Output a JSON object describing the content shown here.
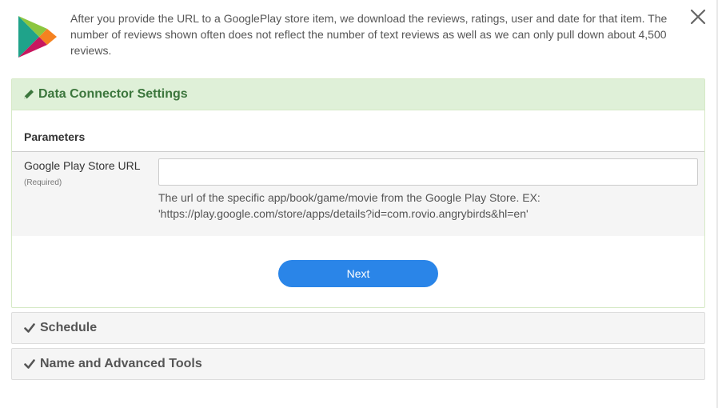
{
  "header": {
    "logo_icon": "google-play-logo-icon",
    "intro_text": "After you provide the URL to a GooglePlay store item, we download the reviews, ratings, user and date for that item. The number of reviews shown often does not reflect the number of text reviews as well as we can only pull down about 4,500 reviews.",
    "close_icon": "close-icon"
  },
  "settings_panel": {
    "title": "Data Connector Settings",
    "title_icon": "pencil-icon",
    "parameters_label": "Parameters",
    "field": {
      "label": "Google Play Store URL",
      "required_note": "(Required)",
      "value": "",
      "placeholder": "",
      "help_text": "The url of the specific app/book/game/movie from the Google Play Store. EX: 'https://play.google.com/store/apps/details?id=com.rovio.angrybirds&hl=en'"
    },
    "next_label": "Next"
  },
  "schedule_panel": {
    "title": "Schedule",
    "icon": "check-icon"
  },
  "advanced_panel": {
    "title": "Name and Advanced Tools",
    "icon": "check-icon"
  },
  "colors": {
    "accent_button": "#2a85e8",
    "success_bg": "#dff0d8",
    "success_text": "#3c763d"
  }
}
